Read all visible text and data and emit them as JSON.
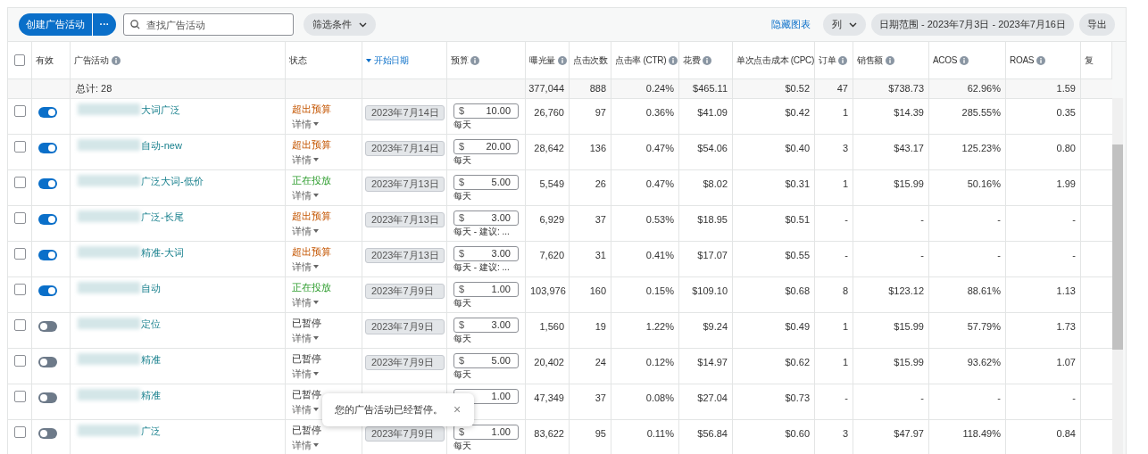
{
  "toolbar": {
    "create_button": "创建广告活动",
    "more_button": "···",
    "search": {
      "placeholder": "查找广告活动"
    },
    "filter_button": "筛选条件",
    "hide_chart_link": "隐藏图表",
    "columns_button": "列",
    "date_range_button": "日期范围 - 2023年7月3日 - 2023年7月16日",
    "export_button": "导出"
  },
  "table": {
    "select_all_checked": false,
    "columns": [
      {
        "label": "有效"
      },
      {
        "label": "广告活动",
        "info": true
      },
      {
        "label": "状态"
      },
      {
        "label": "开始日期",
        "sorted": true
      },
      {
        "label": "预算",
        "info": true
      },
      {
        "label": "曝光量",
        "info": true
      },
      {
        "label": "点击次数"
      },
      {
        "label": "点击率 (CTR)",
        "info": true
      },
      {
        "label": "花费",
        "info": true
      },
      {
        "label": "单次点击成本 (CPC)"
      },
      {
        "label": "订单",
        "info": true
      },
      {
        "label": "销售额",
        "info": true
      },
      {
        "label": "ACOS",
        "info": true
      },
      {
        "label": "ROAS",
        "info": true
      },
      {
        "label": "复"
      }
    ],
    "total": {
      "label": "总计: 28",
      "metrics": [
        "377,044",
        "888",
        "0.24%",
        "$465.11",
        "$0.52",
        "47",
        "$738.73",
        "62.96%",
        "1.59"
      ]
    },
    "rows": [
      {
        "checked": false,
        "enabled": true,
        "name": "大词广泛",
        "status": "超出预算",
        "over_budget": true,
        "running": false,
        "details": "详情",
        "start_date": "2023年7月14日",
        "currency": "$",
        "budget": "10.00",
        "budget_note": "每天",
        "metrics": [
          "26,760",
          "97",
          "0.36%",
          "$41.09",
          "$0.42",
          "1",
          "$14.39",
          "285.55%",
          "0.35"
        ]
      },
      {
        "checked": false,
        "enabled": true,
        "name": "自动-new",
        "status": "超出预算",
        "over_budget": true,
        "running": false,
        "details": "详情",
        "start_date": "2023年7月14日",
        "currency": "$",
        "budget": "20.00",
        "budget_note": "每天",
        "metrics": [
          "28,642",
          "136",
          "0.47%",
          "$54.06",
          "$0.40",
          "3",
          "$43.17",
          "125.23%",
          "0.80"
        ]
      },
      {
        "checked": false,
        "enabled": true,
        "name": "广泛大词-低价",
        "status": "正在投放",
        "over_budget": false,
        "running": true,
        "details": "详情",
        "start_date": "2023年7月13日",
        "currency": "$",
        "budget": "5.00",
        "budget_note": "每天",
        "metrics": [
          "5,549",
          "26",
          "0.47%",
          "$8.02",
          "$0.31",
          "1",
          "$15.99",
          "50.16%",
          "1.99"
        ]
      },
      {
        "checked": false,
        "enabled": true,
        "name": "广泛-长尾",
        "status": "超出预算",
        "over_budget": true,
        "running": false,
        "details": "详情",
        "start_date": "2023年7月13日",
        "currency": "$",
        "budget": "3.00",
        "budget_note": "每天 - 建议: ...",
        "metrics": [
          "6,929",
          "37",
          "0.53%",
          "$18.95",
          "$0.51",
          "-",
          "-",
          "-",
          "-"
        ]
      },
      {
        "checked": false,
        "enabled": true,
        "name": "精准-大词",
        "status": "超出预算",
        "over_budget": true,
        "running": false,
        "details": "详情",
        "start_date": "2023年7月13日",
        "currency": "$",
        "budget": "3.00",
        "budget_note": "每天 - 建议: ...",
        "metrics": [
          "7,620",
          "31",
          "0.41%",
          "$17.07",
          "$0.55",
          "-",
          "-",
          "-",
          "-"
        ]
      },
      {
        "checked": false,
        "enabled": true,
        "name": "自动",
        "status": "正在投放",
        "over_budget": false,
        "running": true,
        "details": "详情",
        "start_date": "2023年7月9日",
        "currency": "$",
        "budget": "1.00",
        "budget_note": "每天",
        "metrics": [
          "103,976",
          "160",
          "0.15%",
          "$109.10",
          "$0.68",
          "8",
          "$123.12",
          "88.61%",
          "1.13"
        ]
      },
      {
        "checked": false,
        "enabled": false,
        "name": "定位",
        "status": "已暂停",
        "over_budget": false,
        "running": false,
        "details": "详情",
        "start_date": "2023年7月9日",
        "currency": "$",
        "budget": "3.00",
        "budget_note": "每天",
        "metrics": [
          "1,560",
          "19",
          "1.22%",
          "$9.24",
          "$0.49",
          "1",
          "$15.99",
          "57.79%",
          "1.73"
        ]
      },
      {
        "checked": false,
        "enabled": false,
        "name": "精准",
        "status": "已暂停",
        "over_budget": false,
        "running": false,
        "details": "详情",
        "start_date": "2023年7月9日",
        "currency": "$",
        "budget": "5.00",
        "budget_note": "每天",
        "metrics": [
          "20,402",
          "24",
          "0.12%",
          "$14.97",
          "$0.62",
          "1",
          "$15.99",
          "93.62%",
          "1.07"
        ]
      },
      {
        "checked": false,
        "enabled": false,
        "name": "精准",
        "status": "已暂停",
        "over_budget": false,
        "running": false,
        "details": "详情",
        "budget": "1.00",
        "metrics": [
          "47,349",
          "37",
          "0.08%",
          "$27.04",
          "$0.73",
          "-",
          "-",
          "-",
          "-"
        ]
      },
      {
        "checked": false,
        "enabled": false,
        "name": "广泛",
        "status": "已暂停",
        "over_budget": false,
        "running": false,
        "details": "详情",
        "start_date": "2023年7月9日",
        "currency": "$",
        "budget": "1.00",
        "budget_note": "每天",
        "metrics": [
          "83,622",
          "95",
          "0.11%",
          "$56.84",
          "$0.60",
          "3",
          "$47.97",
          "118.49%",
          "0.84"
        ]
      }
    ]
  },
  "toast": {
    "message": "您的广告活动已经暂停。",
    "close": "×"
  }
}
